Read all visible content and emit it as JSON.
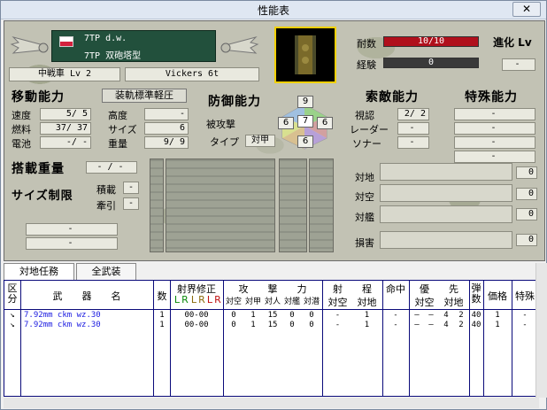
{
  "window": {
    "title": "性能表",
    "close_label": "✕"
  },
  "unit": {
    "flag": "poland-flag",
    "name_line1": "7TP d.w.",
    "name_line2": "7TP 双砲塔型",
    "class_level": "中戦車 Lv 2",
    "base_vehicle": "Vickers 6t"
  },
  "stats": {
    "hp_label": "耐数",
    "hp_value": "10/10",
    "hp_fill": 1.0,
    "exp_label": "経験",
    "exp_value": "0",
    "exp_fill": 0.0,
    "evolution_label": "進化 Lv",
    "evolution_value": "-"
  },
  "mobility": {
    "title": "移動能力",
    "equipment_button": "装軌標準軽圧",
    "speed_label": "速度",
    "speed_value": "5/ 5",
    "fuel_label": "燃料",
    "fuel_value": "37/ 37",
    "battery_label": "電池",
    "battery_value": "-/ -",
    "altitude_label": "高度",
    "altitude_value": "-",
    "size_label": "サイズ",
    "size_value": "6",
    "weight_label": "重量",
    "weight_value": "9/ 9"
  },
  "defense": {
    "title": "防御能力",
    "attacked_label_1": "被攻撃",
    "attacked_label_2": "タイプ",
    "attacked_value": "対甲",
    "armor_top": "9",
    "armor_front": "7",
    "armor_left": "6",
    "armor_right": "6",
    "armor_bottom": "6"
  },
  "search": {
    "title": "索敵能力",
    "vision_label": "視認",
    "vision_value": "2/ 2",
    "radar_label": "レーダー",
    "radar_value": "-",
    "sonar_label": "ソナー",
    "sonar_value": "-"
  },
  "special": {
    "title": "特殊能力",
    "slots": [
      "-",
      "-",
      "-",
      "-"
    ]
  },
  "loading": {
    "weight_title": "搭載重量",
    "weight_value": "- / -",
    "size_limit_title": "サイズ制限",
    "load_label": "積載",
    "load_value": "-",
    "tow_label": "牽引",
    "tow_value": "-",
    "bottom1": "-",
    "bottom2": "-"
  },
  "capabilities": {
    "ground_label": "対地",
    "ground_value": "0",
    "air_label": "対空",
    "air_value": "0",
    "ship_label": "対艦",
    "ship_value": "0",
    "damage_label": "損害",
    "damage_value": "0"
  },
  "tabs": [
    "対地任務",
    "全武装"
  ],
  "table": {
    "headers": {
      "kubun": "区分",
      "weapon": "武　　器　　名",
      "count": "数",
      "fire_limit": "射界修正",
      "fire_lr": [
        "L",
        "R",
        "L",
        "R",
        "L",
        "R"
      ],
      "attack": "攻　　撃　　力",
      "attack_sub": [
        "対空",
        "対甲",
        "対人",
        "対艦",
        "対潜"
      ],
      "range": "射　　程",
      "range_sub": [
        "対空",
        "対地"
      ],
      "accuracy": "命中",
      "priority": "優　　先",
      "priority_sub": [
        "対空",
        "対地"
      ],
      "ammo": "弾数",
      "price": "価格",
      "special": "特殊"
    },
    "rows": [
      {
        "weapon": "7.92mm ckm wz.30",
        "count": "1",
        "fire": "00-00",
        "atk_air": "0",
        "atk_armor": "1",
        "atk_person": "15",
        "atk_ship": "0",
        "atk_sub": "0",
        "rng_air": "-",
        "rng_ground": "1",
        "acc": "-",
        "pri_a": "—",
        "pri_b": "—",
        "pri_air": "4",
        "pri_ground": "2",
        "ammo": "40",
        "price": "1",
        "special": "-"
      },
      {
        "weapon": "7.92mm ckm wz.30",
        "count": "1",
        "fire": "00-00",
        "atk_air": "0",
        "atk_armor": "1",
        "atk_person": "15",
        "atk_ship": "0",
        "atk_sub": "0",
        "rng_air": "-",
        "rng_ground": "1",
        "acc": "-",
        "pri_a": "—",
        "pri_b": "—",
        "pri_air": "4",
        "pri_ground": "2",
        "ammo": "40",
        "price": "1",
        "special": "-"
      }
    ]
  },
  "colors": {
    "hp_bar": "#b0101c",
    "exp_bar": "#3a3a3a",
    "weapon_text": "#1a1ae0",
    "grid": "#0a0a7a"
  }
}
